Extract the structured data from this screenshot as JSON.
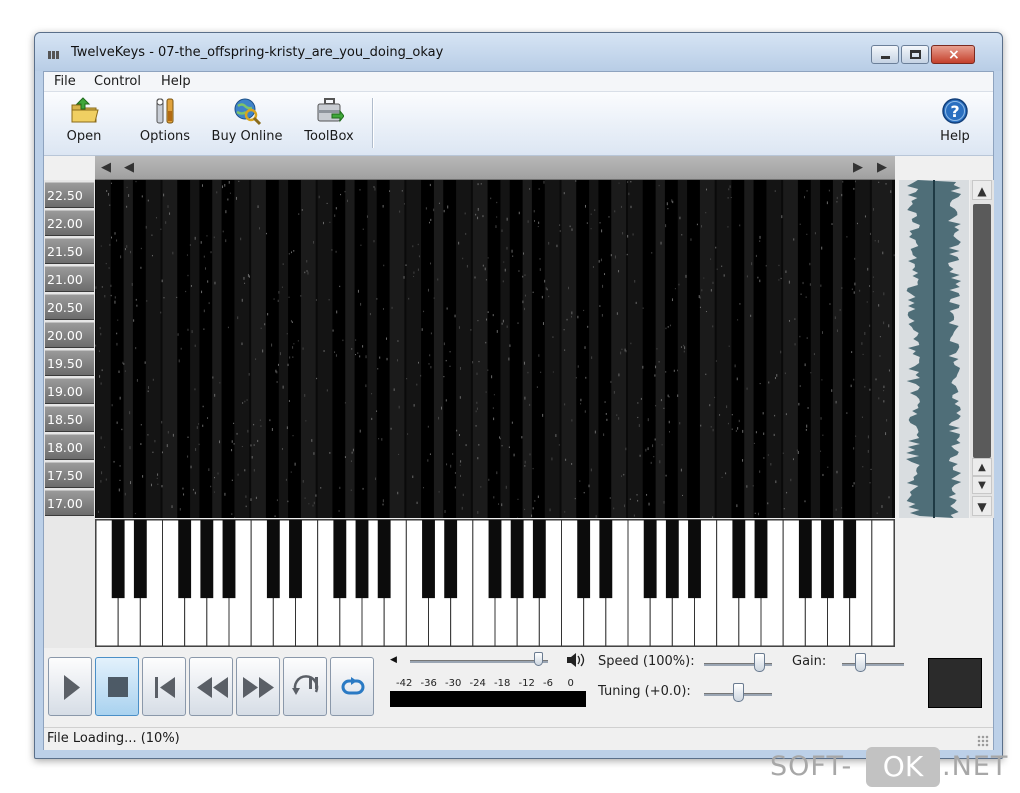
{
  "window": {
    "title": "TwelveKeys - 07-the_offspring-kristy_are_you_doing_okay",
    "close_glyph": "×"
  },
  "menu": {
    "items": [
      "File",
      "Control",
      "Help"
    ]
  },
  "toolbar": {
    "open_label": "Open",
    "options_label": "Options",
    "buy_online_label": "Buy Online",
    "toolbox_label": "ToolBox",
    "help_label": "Help"
  },
  "scroll_arrows": {
    "left_end": "◀",
    "left": "◀",
    "right": "▶",
    "right_end": "▶",
    "up": "▲",
    "zoom_up": "▲",
    "zoom_down": "▼",
    "down": "▼"
  },
  "ruler": {
    "labels": [
      "22.50",
      "22.00",
      "21.50",
      "21.00",
      "20.50",
      "20.00",
      "19.50",
      "19.00",
      "18.50",
      "18.00",
      "17.50",
      "17.00"
    ]
  },
  "piano": {
    "white_key_count": 36
  },
  "volume": {
    "level": 0.96,
    "vu_scale": [
      "-42",
      "-36",
      "-30",
      "-24",
      "-18",
      "-12",
      "-6",
      "0"
    ]
  },
  "sliders": {
    "speed_label": "Speed (100%):",
    "speed_level": 0.88,
    "tuning_label": "Tuning (+0.0):",
    "tuning_level": 0.5,
    "gain_label": "Gain:",
    "gain_level": 0.25
  },
  "colors": {
    "waveform": "#4f6e78",
    "spectrogram_bg": "#0a0a0a",
    "color_box": "#2b2b2b"
  },
  "status": {
    "text": "File Loading... (10%)"
  },
  "watermark": {
    "prefix": "SOFT-",
    "ok": "OK",
    "suffix": ".NET"
  }
}
